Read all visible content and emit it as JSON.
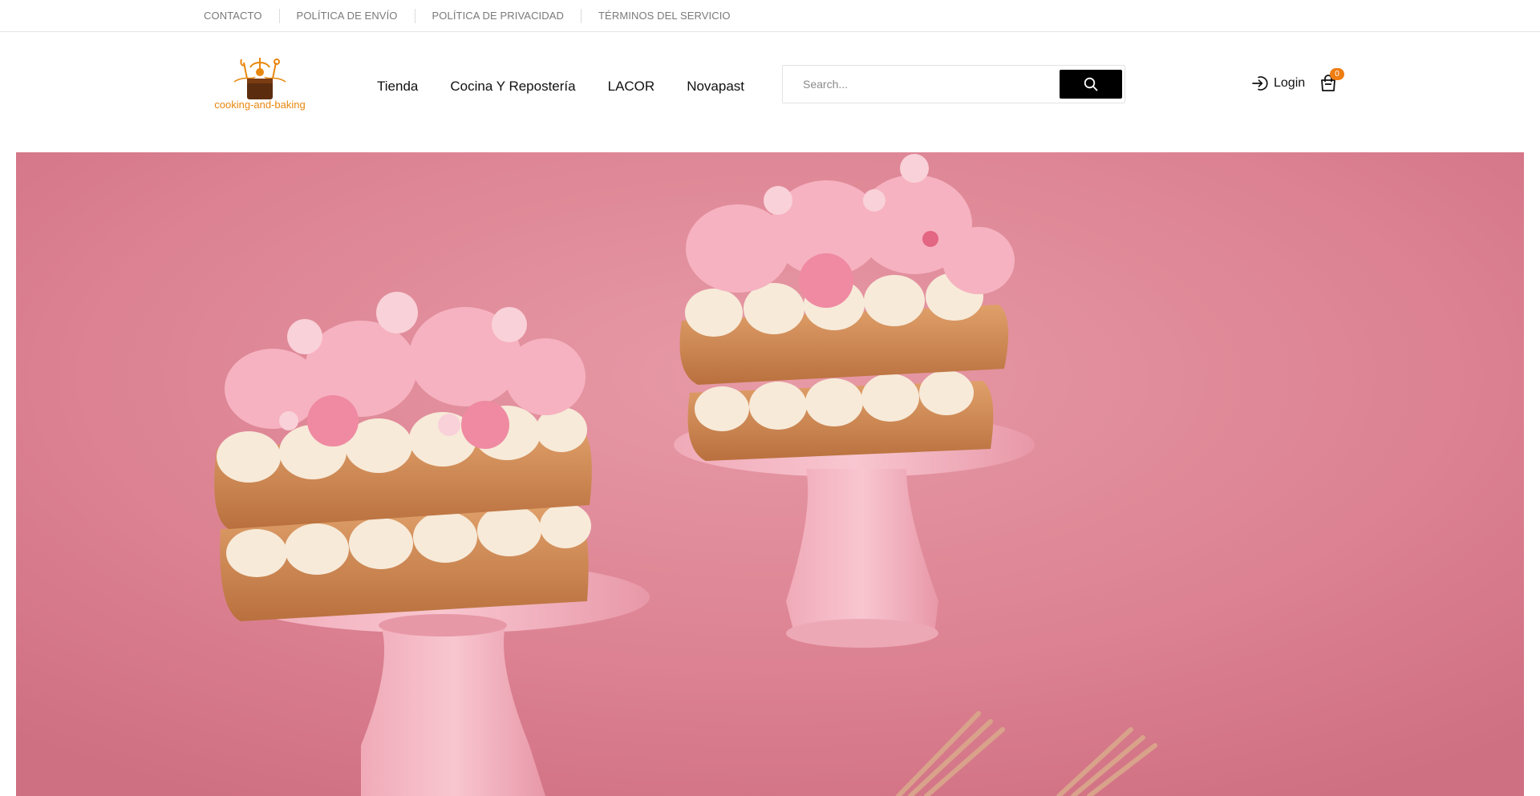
{
  "topbar": {
    "links": [
      "CONTACTO",
      "POLÍTICA DE ENVÍO",
      "POLÍTICA DE PRIVACIDAD",
      "TÉRMINOS DEL SERVICIO"
    ]
  },
  "header": {
    "logo_text": "cooking-and-baking",
    "nav": [
      "Tienda",
      "Cocina Y Repostería",
      "LACOR",
      "Novapast"
    ],
    "search": {
      "placeholder": "Search..."
    },
    "login_label": "Login",
    "cart_count": "0"
  },
  "colors": {
    "brand_orange": "#ef7d12",
    "logo_brown": "#5b2d0e",
    "hero_pink": "#d97d8d",
    "search_button": "#000000"
  },
  "icons": {
    "search_button": "search-icon",
    "login": "login-icon",
    "cart": "shopping-bag-icon"
  },
  "hero": {
    "image": "two pink cream-filled pastries on pink cake stands with forks"
  }
}
